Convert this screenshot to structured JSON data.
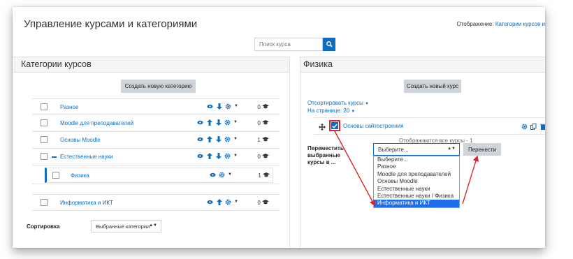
{
  "header": {
    "title": "Управление курсами и категориями",
    "view_label": "Отображение:",
    "view_value": "Категории курсов и"
  },
  "search": {
    "placeholder": "Поиск курса"
  },
  "left_panel": {
    "title": "Категории курсов",
    "create_button": "Создать новую категорию",
    "categories": [
      {
        "name": "Разное",
        "count": "0"
      },
      {
        "name": "Moodle для преподавателей",
        "count": "0"
      },
      {
        "name": "Основы Moodle",
        "count": "1"
      },
      {
        "name": "Естественные науки",
        "count": "0"
      }
    ],
    "subcategory": {
      "name": "Физика",
      "count": "1"
    },
    "last_category": {
      "name": "Информатика и ИКТ",
      "count": "0"
    },
    "sort_label": "Сортировка",
    "sort_select": "Выбранные категории"
  },
  "right_panel": {
    "title": "Физика",
    "create_button": "Создать новый курс",
    "sort_link": "Отсортировать курсы",
    "per_page": "На странице: 20",
    "course_name": "Основы сайтостроения",
    "shown_all": "Отображаются все курсы - 1",
    "move_label": "Переместить выбранные курсы в ...",
    "move_select": "Выберите...",
    "move_button": "Перенести",
    "dropdown_options": [
      "Выберите...",
      "Разное",
      "Moodle для преподавателей",
      "Основы Moodle",
      "Естественные науки",
      "Естественные науки / Физика",
      "Информатика и ИКТ"
    ],
    "dropdown_selected_index": 6
  },
  "colors": {
    "accent": "#0f6cbf",
    "annotation": "#d9262d",
    "selected_option": "#1e6ee8"
  }
}
